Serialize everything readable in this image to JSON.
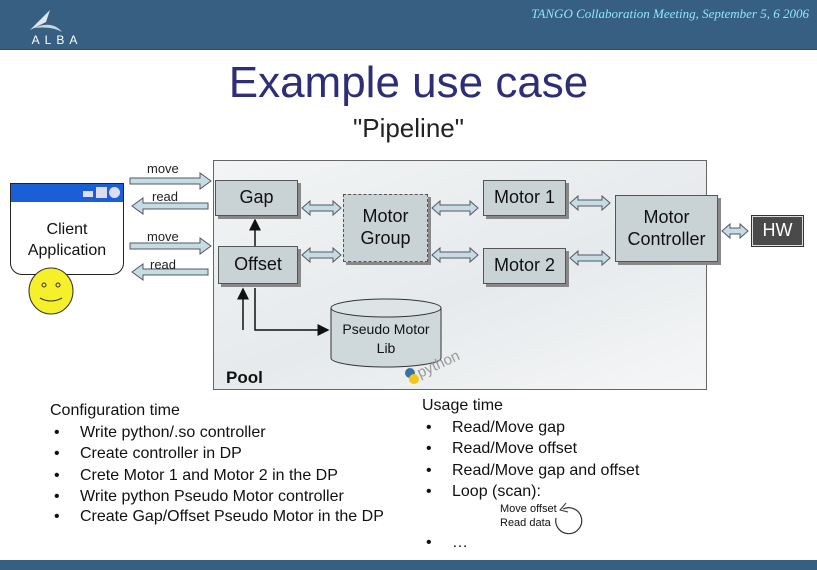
{
  "header": {
    "logo_text": "ALBA",
    "meeting": "TANGO Collaboration Meeting, September 5, 6 2006",
    "bg_color": "#365f82"
  },
  "slide": {
    "title": "Example use case",
    "subtitle": "\"Pipeline\""
  },
  "diagram": {
    "client": {
      "label_line1": "Client",
      "label_line2": "Application"
    },
    "arrows": {
      "move1": "move",
      "read1": "read",
      "move2": "move",
      "read2": "read"
    },
    "pool_label": "Pool",
    "gap": "Gap",
    "offset": "Offset",
    "motor_group_line1": "Motor",
    "motor_group_line2": "Group",
    "motor1": "Motor 1",
    "motor2": "Motor 2",
    "controller_line1": "Motor",
    "controller_line2": "Controller",
    "hw": "HW",
    "lib_line1": "Pseudo Motor",
    "lib_line2": "Lib",
    "python_logo": "python"
  },
  "configuration": {
    "heading": "Configuration time",
    "items": [
      "Write python/.so controller",
      "Create controller in DP",
      "Crete Motor 1 and Motor 2 in the DP",
      "Write python Pseudo Motor controller",
      "Create Gap/Offset Pseudo Motor in the DP"
    ]
  },
  "usage": {
    "heading": "Usage time",
    "items": [
      "Read/Move gap",
      "Read/Move offset",
      "Read/Move gap and offset",
      "Loop (scan):"
    ],
    "loop_line1": "Move offset",
    "loop_line2": "Read data",
    "last_item": "…"
  }
}
